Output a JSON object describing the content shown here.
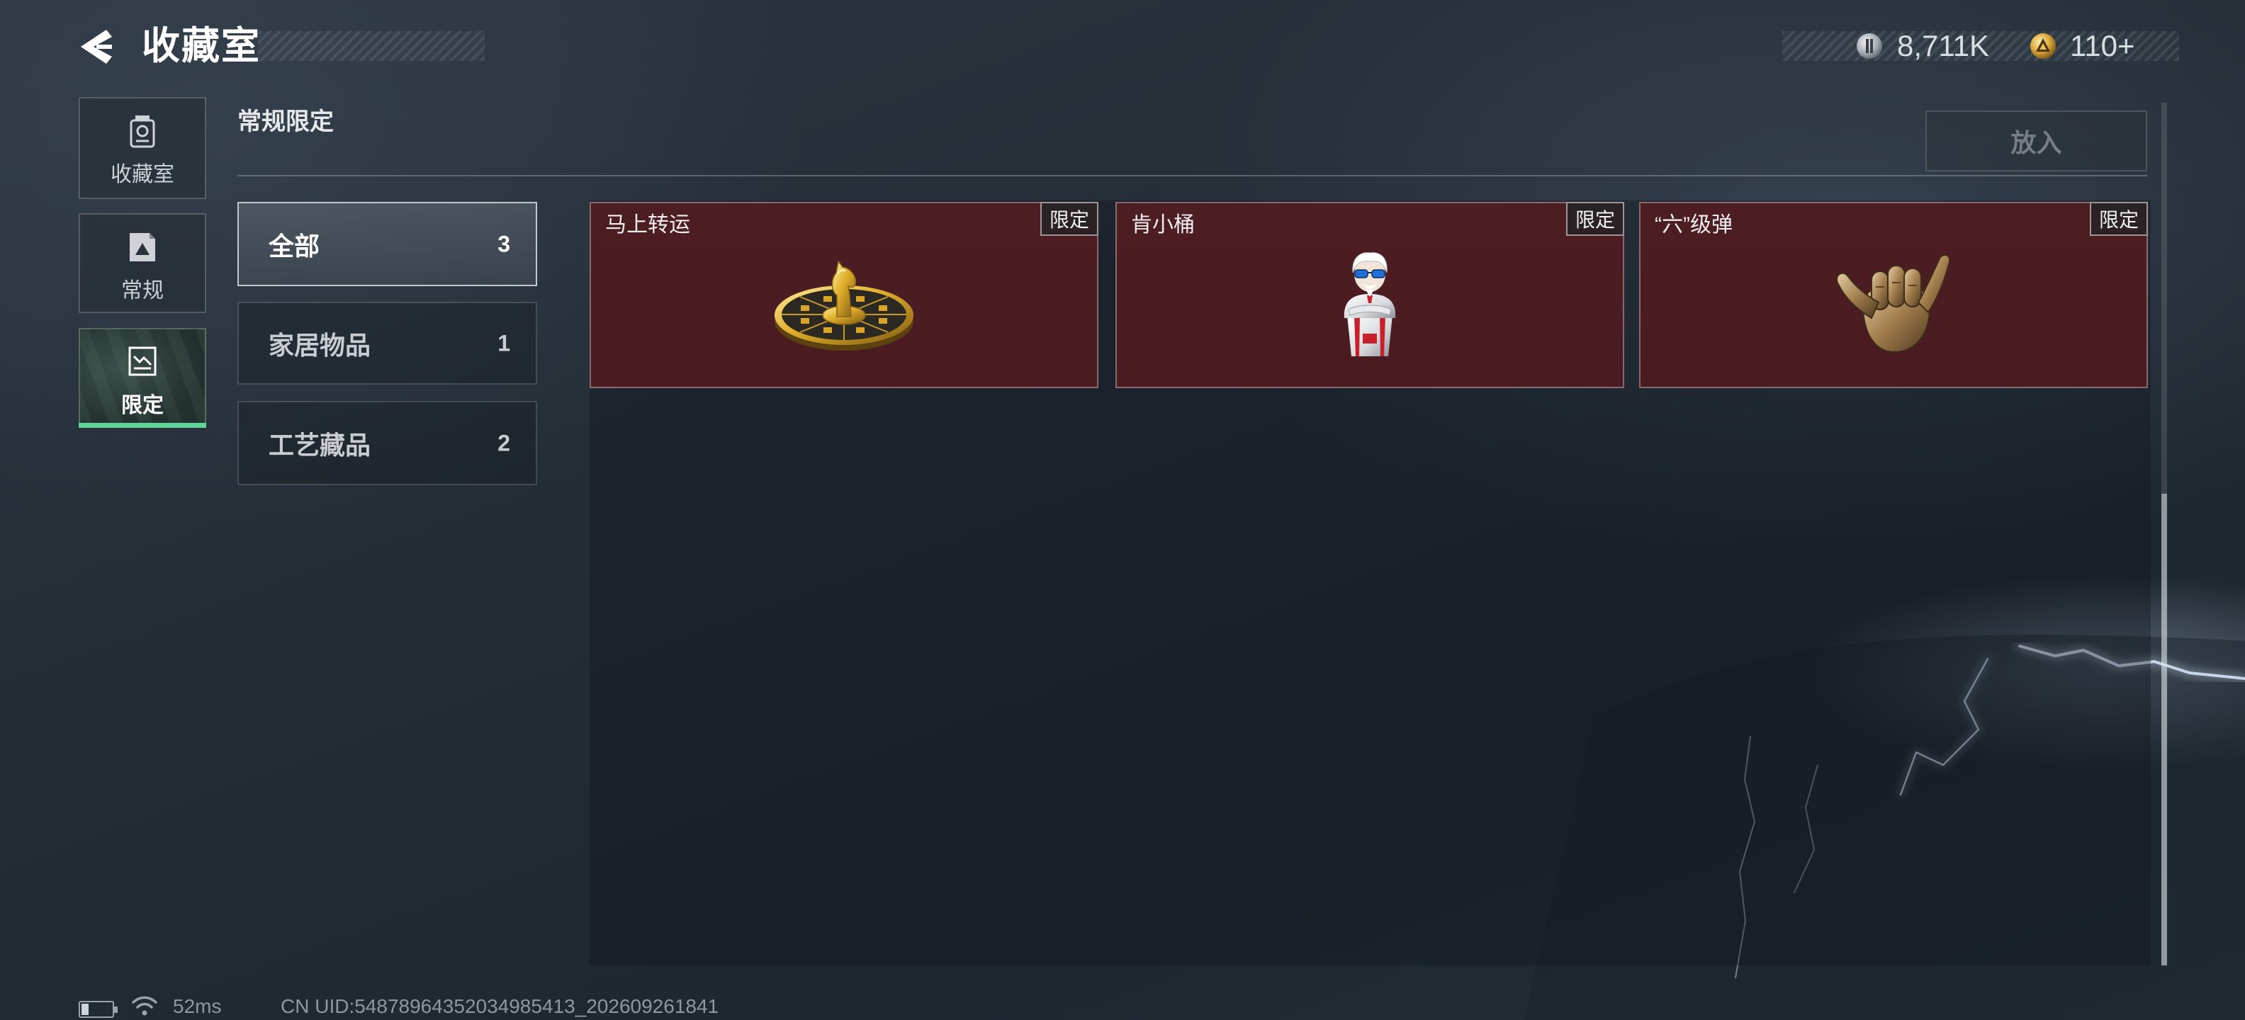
{
  "header": {
    "title": "收藏室",
    "back_icon": "back-arrow-icon",
    "currencies": [
      {
        "icon": "silver-coin-icon",
        "value": "8,711K"
      },
      {
        "icon": "gold-coin-icon",
        "value": "110+"
      }
    ]
  },
  "sidebar": {
    "items": [
      {
        "label": "收藏室",
        "icon": "collection-cabinet-icon",
        "active": false
      },
      {
        "label": "常规",
        "icon": "picture-icon",
        "active": false
      },
      {
        "label": "限定",
        "icon": "limited-picture-icon",
        "active": true
      }
    ]
  },
  "section": {
    "title": "常规限定",
    "put_in_label": "放入"
  },
  "categories": [
    {
      "label": "全部",
      "count": 3,
      "active": true
    },
    {
      "label": "家居物品",
      "count": 1,
      "active": false
    },
    {
      "label": "工艺藏品",
      "count": 2,
      "active": false
    }
  ],
  "items": [
    {
      "name": "马上转运",
      "tag": "限定",
      "icon": "golden-horse-disc-image"
    },
    {
      "name": "肯小桶",
      "tag": "限定",
      "icon": "colonel-bucket-figurine-image"
    },
    {
      "name": "“六”级弹",
      "tag": "限定",
      "icon": "shaka-hand-sculpture-image"
    }
  ],
  "status": {
    "battery_level": 0.3,
    "latency": "52ms",
    "uid": "CN UID:54878964352034985413_202609261841"
  },
  "theme": {
    "accent": "#5fd39a",
    "card-bg": "#4a1b21"
  }
}
